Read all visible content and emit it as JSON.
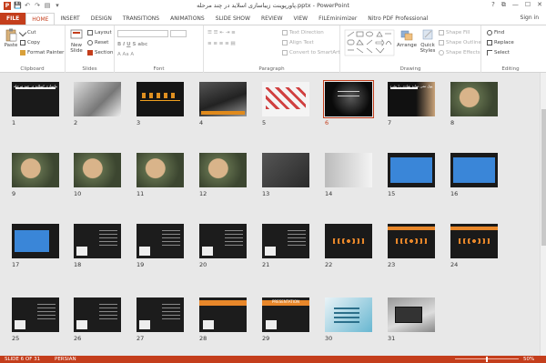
{
  "window": {
    "title": "پاورپوینت زیباسازی اسلاید در چند مرحله.pptx - PowerPoint",
    "controls": [
      "?",
      "⧉",
      "—",
      "☐",
      "✕"
    ]
  },
  "quick_access": [
    "P",
    "💾",
    "↶",
    "↷",
    "▤",
    "▾"
  ],
  "tabs": [
    "FILE",
    "HOME",
    "INSERT",
    "DESIGN",
    "TRANSITIONS",
    "ANIMATIONS",
    "SLIDE SHOW",
    "REVIEW",
    "VIEW",
    "FILEminimizer",
    "Nitro PDF Professional"
  ],
  "active_tab": "HOME",
  "signin": "Sign in",
  "ribbon": {
    "clipboard": {
      "label": "Clipboard",
      "paste": "Paste",
      "cut": "Cut",
      "copy": "Copy",
      "format_painter": "Format Painter"
    },
    "slides": {
      "label": "Slides",
      "new_slide": "New Slide",
      "layout": "Layout",
      "reset": "Reset",
      "section": "Section"
    },
    "font": {
      "label": "Font"
    },
    "paragraph": {
      "label": "Paragraph",
      "text_direction": "Text Direction",
      "align_text": "Align Text",
      "convert_smartart": "Convert to SmartArt"
    },
    "drawing": {
      "label": "Drawing",
      "arrange": "Arrange",
      "quick_styles": "Quick Styles",
      "shape_fill": "Shape Fill",
      "shape_outline": "Shape Outline",
      "shape_effects": "Shape Effects"
    },
    "editing": {
      "label": "Editing",
      "find": "Find",
      "replace": "Replace",
      "select": "Select"
    }
  },
  "slides": [
    {
      "num": "1",
      "title": "زیباسازی اسلاید در چند مرحله",
      "style": "dark-title"
    },
    {
      "num": "2",
      "title": "",
      "style": "bw-photo"
    },
    {
      "num": "3",
      "title": "",
      "style": "dark-timeline"
    },
    {
      "num": "4",
      "title": "",
      "style": "crowd"
    },
    {
      "num": "5",
      "title": "",
      "style": "white-items"
    },
    {
      "num": "6",
      "title": "",
      "style": "dark-spot"
    },
    {
      "num": "7",
      "title": "پول نمی تواند شادی را بخرد",
      "style": "dark-face"
    },
    {
      "num": "8",
      "title": "",
      "style": "money-face"
    },
    {
      "num": "9",
      "title": "",
      "style": "money-face"
    },
    {
      "num": "10",
      "title": "",
      "style": "money-face"
    },
    {
      "num": "11",
      "title": "",
      "style": "money-face"
    },
    {
      "num": "12",
      "title": "",
      "style": "money-face"
    },
    {
      "num": "13",
      "title": "",
      "style": "grey-money"
    },
    {
      "num": "14",
      "title": "",
      "style": "bw-books"
    },
    {
      "num": "15",
      "title": "",
      "style": "blue-box"
    },
    {
      "num": "16",
      "title": "",
      "style": "blue-box"
    },
    {
      "num": "17",
      "title": "",
      "style": "blue-box-left"
    },
    {
      "num": "18",
      "title": "",
      "style": "dark-note"
    },
    {
      "num": "19",
      "title": "",
      "style": "dark-note"
    },
    {
      "num": "20",
      "title": "",
      "style": "dark-note"
    },
    {
      "num": "21",
      "title": "",
      "style": "dark-note"
    },
    {
      "num": "22",
      "title": "",
      "style": "dark-circles"
    },
    {
      "num": "23",
      "title": "",
      "style": "orange-circles"
    },
    {
      "num": "24",
      "title": "",
      "style": "orange-circles"
    },
    {
      "num": "25",
      "title": "",
      "style": "dark-note"
    },
    {
      "num": "26",
      "title": "",
      "style": "dark-note"
    },
    {
      "num": "27",
      "title": "",
      "style": "dark-note"
    },
    {
      "num": "28",
      "title": "",
      "style": "orange-bar"
    },
    {
      "num": "29",
      "title": "PRESENTATION",
      "style": "orange-bar"
    },
    {
      "num": "30",
      "title": "",
      "style": "teal-photo"
    },
    {
      "num": "31",
      "title": "",
      "style": "laptop"
    }
  ],
  "selected_slide": "6",
  "status": {
    "slide": "SLIDE 6 OF 31",
    "language": "PERSIAN",
    "zoom": "50%"
  },
  "colors": {
    "accent": "#c43e1c",
    "workspace": "#e8e8e8"
  }
}
